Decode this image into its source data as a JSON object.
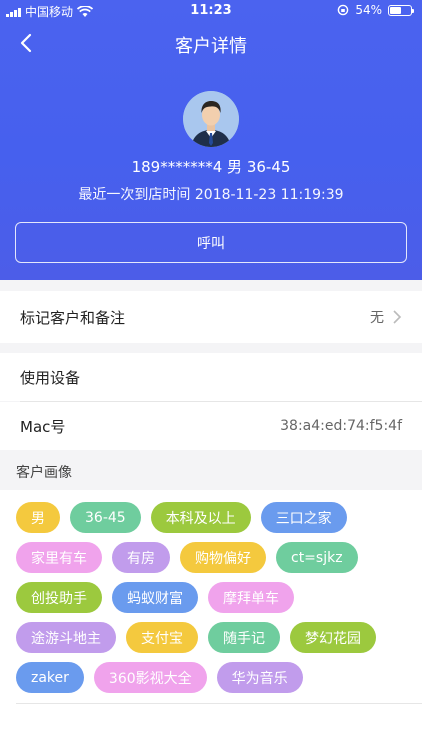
{
  "status_bar": {
    "carrier": "中国移动",
    "time": "11:23",
    "battery": "54%",
    "battery_level": 0.54
  },
  "nav": {
    "title": "客户详情"
  },
  "customer": {
    "phone": "189*******4",
    "gender": "男",
    "age_range": "36-45",
    "last_visit_label": "最近一次到店时间",
    "last_visit_time": "2018-11-23 11:19:39",
    "call_label": "呼叫"
  },
  "remark": {
    "label": "标记客户和备注",
    "value": "无"
  },
  "device": {
    "title": "使用设备",
    "mac_label": "Mac号",
    "mac_value": "38:a4:ed:74:f5:4f"
  },
  "portrait": {
    "label": "客户画像",
    "tag_rows": [
      [
        {
          "text": "男",
          "color": "yellow"
        },
        {
          "text": "36-45",
          "color": "green"
        },
        {
          "text": "本科及以上",
          "color": "olive"
        },
        {
          "text": "三口之家",
          "color": "blue"
        }
      ],
      [
        {
          "text": "家里有车",
          "color": "pink"
        },
        {
          "text": "有房",
          "color": "purple"
        },
        {
          "text": "购物偏好",
          "color": "yellow"
        },
        {
          "text": "ct=sjkz",
          "color": "green"
        }
      ],
      [
        {
          "text": "创投助手",
          "color": "olive"
        },
        {
          "text": "蚂蚁财富",
          "color": "blue"
        },
        {
          "text": "摩拜单车",
          "color": "pink"
        }
      ],
      [
        {
          "text": "途游斗地主",
          "color": "purple"
        },
        {
          "text": "支付宝",
          "color": "yellow"
        },
        {
          "text": "随手记",
          "color": "green"
        },
        {
          "text": "梦幻花园",
          "color": "olive"
        }
      ],
      [
        {
          "text": "zaker",
          "color": "blue"
        },
        {
          "text": "360影视大全",
          "color": "pink"
        },
        {
          "text": "华为音乐",
          "color": "purple"
        }
      ]
    ]
  },
  "colors": {
    "header_blue": "#4660ee",
    "tag_yellow": "#f4c93e",
    "tag_green": "#6fcd9e",
    "tag_olive": "#9cc93e",
    "tag_blue": "#6a9bee",
    "tag_pink": "#f0a3ec",
    "tag_purple": "#c19cec"
  },
  "icons": [
    "signal-icon",
    "wifi-icon",
    "back-arrow-icon",
    "rotation-lock-icon",
    "battery-icon",
    "chevron-right-icon",
    "avatar"
  ]
}
